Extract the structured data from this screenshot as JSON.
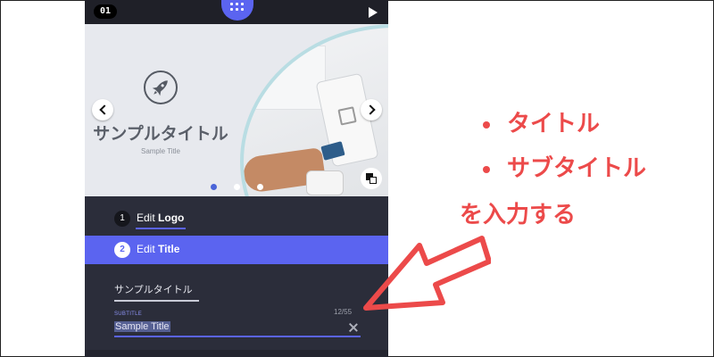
{
  "app": {
    "slide_number": "01",
    "grid_button": "grid-icon",
    "play_button": "play-icon"
  },
  "slide": {
    "title": "サンプルタイトル",
    "subtitle": "Sample Title",
    "icon": "rocket-icon",
    "pagination": {
      "count": 3,
      "active": 1
    }
  },
  "steps": [
    {
      "number": "1",
      "prefix": "Edit",
      "label": "Logo",
      "active": false
    },
    {
      "number": "2",
      "prefix": "Edit",
      "label": "Title",
      "active": true
    }
  ],
  "form": {
    "title_value": "サンプルタイトル",
    "subtitle_label": "SUBTITLE",
    "subtitle_value": "Sample Title",
    "char_counter": "12/55"
  },
  "annotation": {
    "bullets": [
      "タイトル",
      "サブタイトル"
    ],
    "caption": "を入力する"
  },
  "colors": {
    "accent": "#5b64f0",
    "panel": "#2b2d3a",
    "annotation_red": "#ec4a4a"
  }
}
